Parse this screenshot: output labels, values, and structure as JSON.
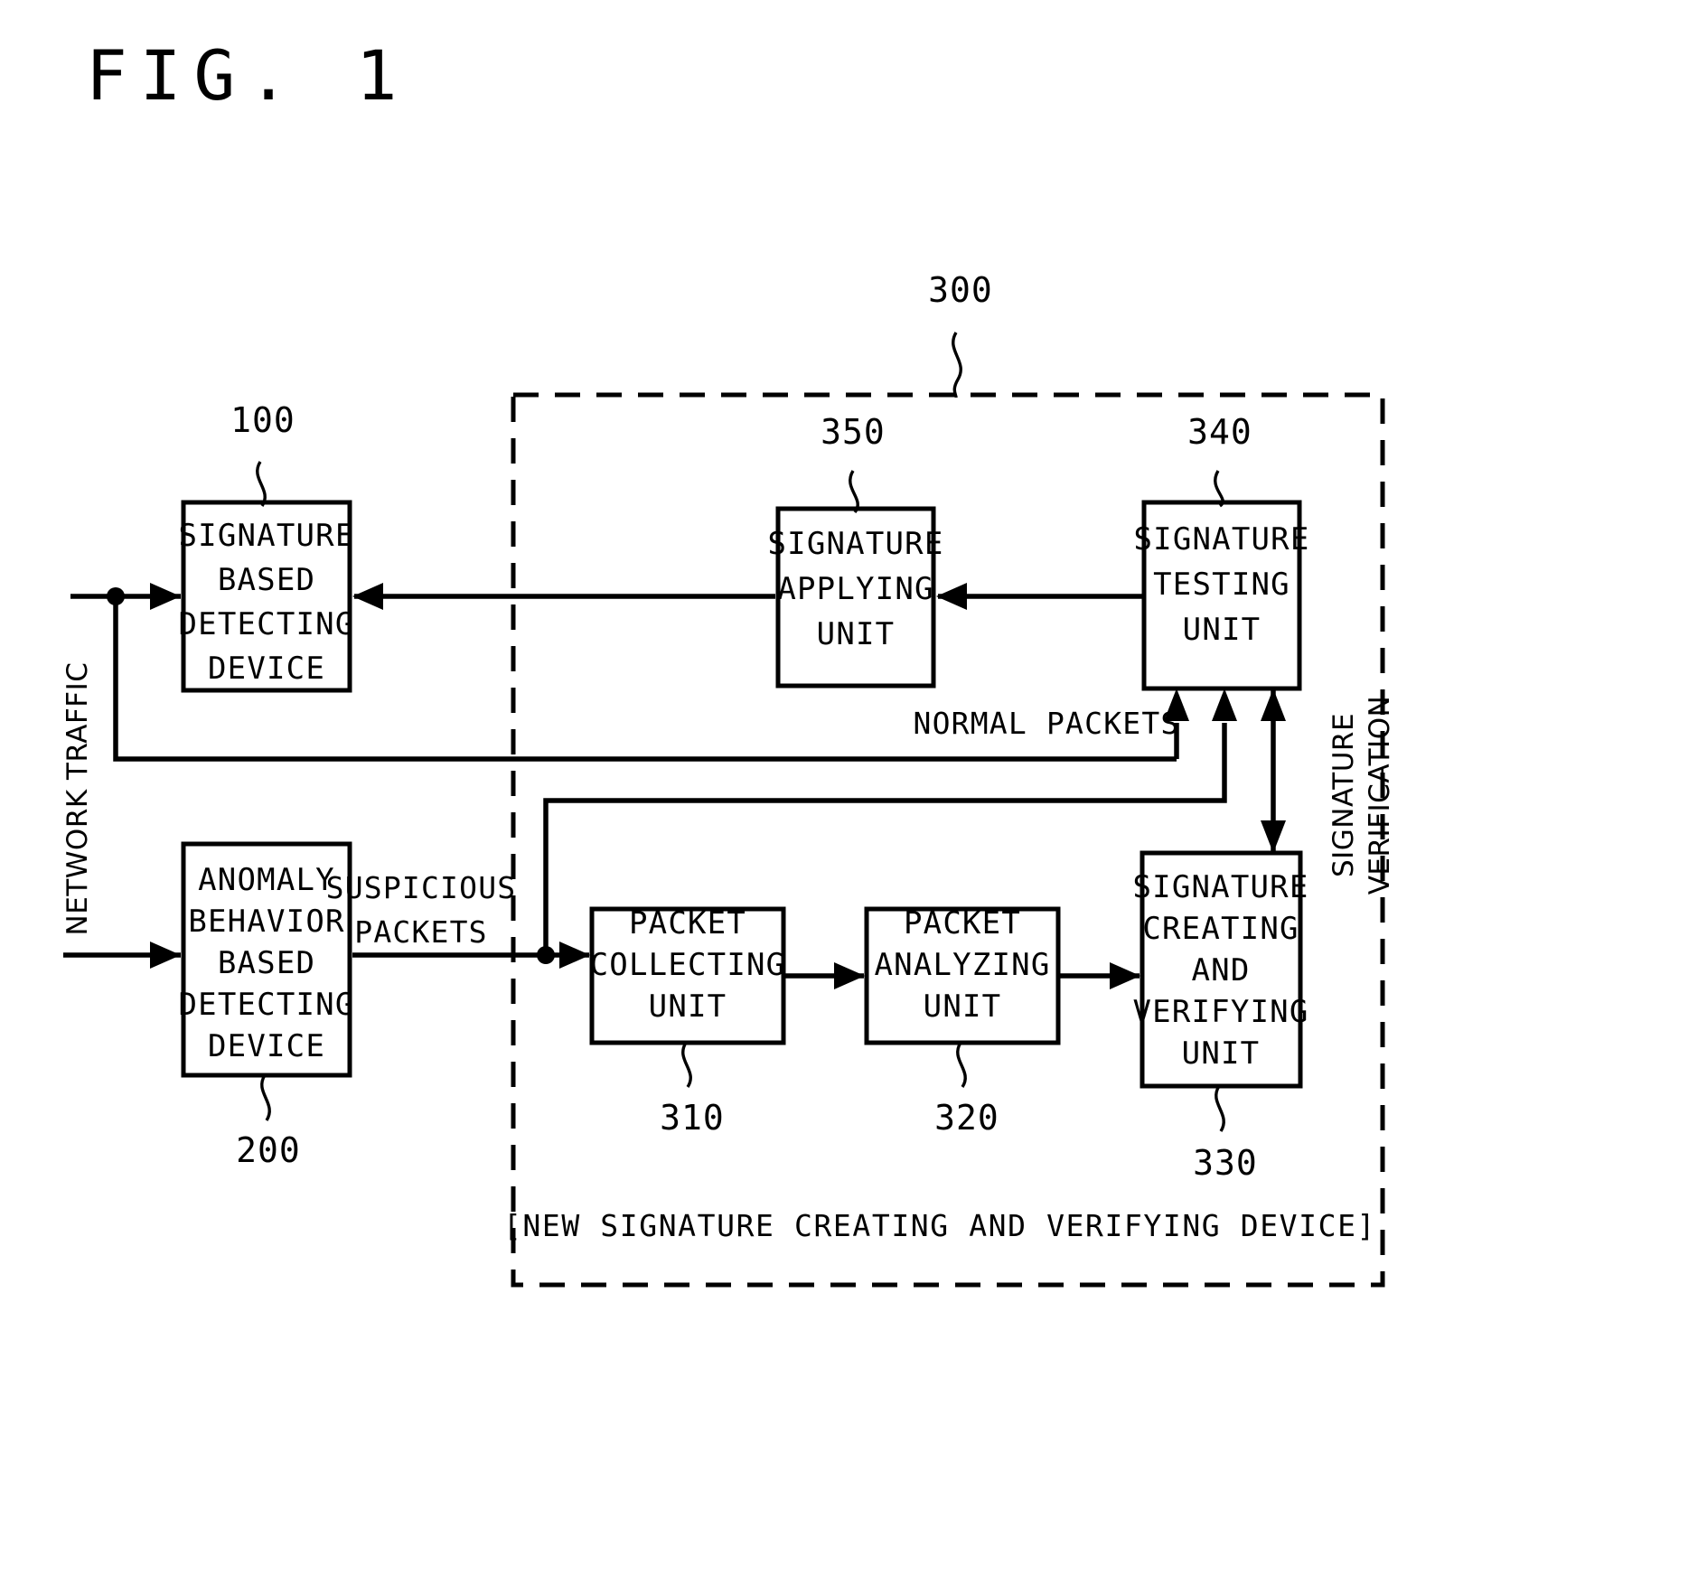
{
  "figure": {
    "title": "FIG. 1"
  },
  "boxes": {
    "signature_based_detecting_device": {
      "ref": "100",
      "lines": [
        "SIGNATURE",
        "BASED",
        "DETECTING",
        "DEVICE"
      ]
    },
    "anomaly_behavior_based_detecting_device": {
      "ref": "200",
      "lines": [
        "ANOMALY",
        "BEHAVIOR",
        "BASED",
        "DETECTING",
        "DEVICE"
      ]
    },
    "signature_applying_unit": {
      "ref": "350",
      "lines": [
        "SIGNATURE",
        "APPLYING",
        "UNIT"
      ]
    },
    "signature_testing_unit": {
      "ref": "340",
      "lines": [
        "SIGNATURE",
        "TESTING",
        "UNIT"
      ]
    },
    "packet_collecting_unit": {
      "ref": "310",
      "lines": [
        "PACKET",
        "COLLECTING",
        "UNIT"
      ]
    },
    "packet_analyzing_unit": {
      "ref": "320",
      "lines": [
        "PACKET",
        "ANALYZING",
        "UNIT"
      ]
    },
    "signature_creating_and_verifying_unit": {
      "ref": "330",
      "lines": [
        "SIGNATURE",
        "CREATING",
        "AND",
        "VERIFYING",
        "UNIT"
      ]
    }
  },
  "container": {
    "ref": "300",
    "caption": "[NEW SIGNATURE CREATING AND VERIFYING DEVICE]"
  },
  "flow_labels": {
    "network_traffic": "NETWORK TRAFFIC",
    "suspicious_packets_line1": "SUSPICIOUS",
    "suspicious_packets_line2": "PACKETS",
    "normal_packets": "NORMAL PACKETS",
    "signature_verification_line1": "SIGNATURE",
    "signature_verification_line2": "VERIFICATION"
  },
  "colors": {
    "ink": "#000000",
    "paper": "#ffffff"
  }
}
